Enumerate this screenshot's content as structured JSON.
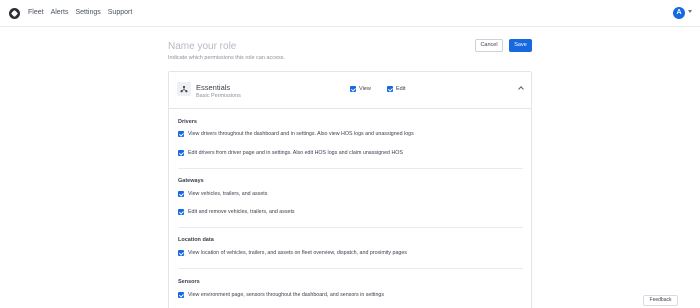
{
  "nav": {
    "items": [
      "Fleet",
      "Alerts",
      "Settings",
      "Support"
    ],
    "avatar_initial": "A"
  },
  "role": {
    "name_placeholder": "Name your role",
    "description": "Indicate which permissions this role can access."
  },
  "actions": {
    "cancel_label": "Cancel",
    "save_label": "Save"
  },
  "card": {
    "title": "Essentials",
    "subtitle": "Basic Permissions",
    "view_label": "View",
    "edit_label": "Edit",
    "view_checked": true,
    "edit_checked": true
  },
  "sections": [
    {
      "title": "Drivers",
      "permissions": [
        "View drivers throughout the dashboard and in settings. Also view HOS logs and unassigned logs",
        "Edit drivers from driver page and in settings. Also edit HOS logs and claim unassigned HOS"
      ]
    },
    {
      "title": "Gateways",
      "permissions": [
        "View vehicles, trailers, and assets",
        "Edit and remove vehicles, trailers, and assets"
      ]
    },
    {
      "title": "Location data",
      "permissions": [
        "View location of vehicles, trailers, and assets on fleet overview, dispatch, and proximity pages"
      ]
    },
    {
      "title": "Sensors",
      "permissions": [
        "View environment page, sensors throughout the dashboard, and sensors in settings"
      ]
    }
  ],
  "feedback_label": "Feedback",
  "colors": {
    "accent": "#1769e0",
    "border": "#e2e6eb",
    "text": "#3a3f4b",
    "muted": "#8a919c"
  },
  "icons": {
    "logo": "company-logo",
    "essentials": "hub-nodes-icon",
    "collapse": "chevron-up-icon",
    "checkbox": "checkmark-icon"
  }
}
